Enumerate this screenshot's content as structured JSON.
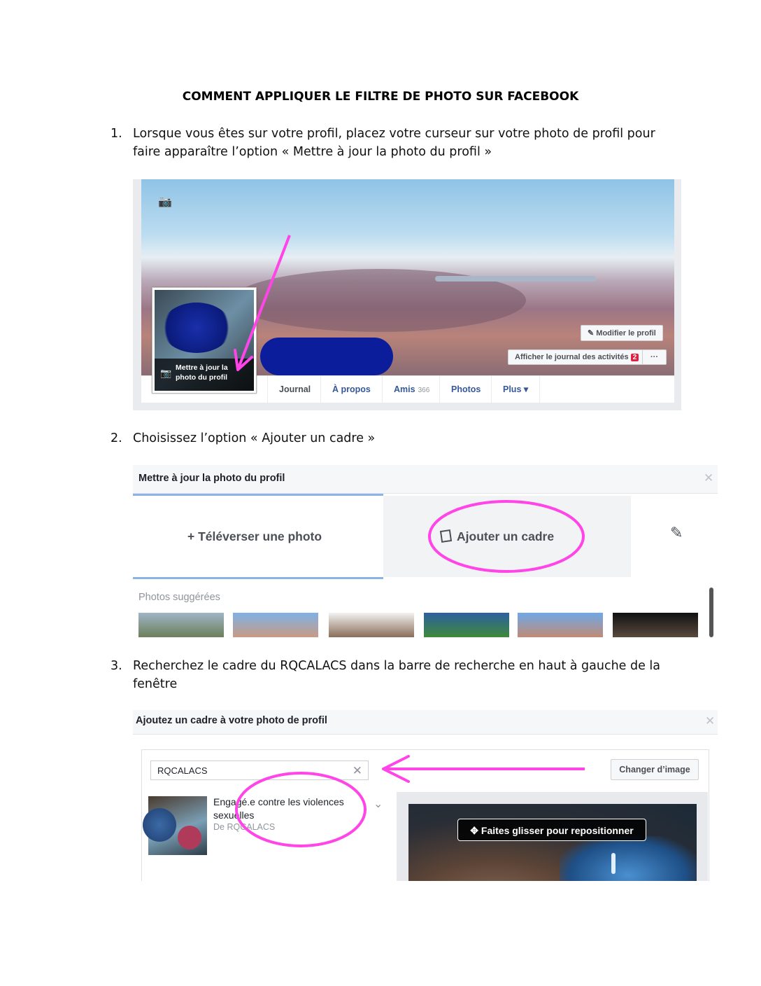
{
  "title": "COMMENT APPLIQUER LE FILTRE DE PHOTO SUR FACEBOOK",
  "steps": [
    {
      "num": "1.",
      "text": "Lorsque vous êtes sur votre profil, placez votre curseur sur votre photo de profil pour faire apparaître l’option « Mettre à jour la photo du profil »"
    },
    {
      "num": "2.",
      "text": "Choisissez l’option « Ajouter un cadre »"
    },
    {
      "num": "3.",
      "text": "Recherchez le cadre du RQCALACS dans la barre de recherche en haut à gauche de la fenêtre"
    }
  ],
  "shot1": {
    "edit_profile": "Modifier le profil",
    "activity_log": "Afficher le journal des activités",
    "activity_badge": "2",
    "more": "···",
    "avatar_overlay": "Mettre à jour la photo du profil",
    "tabs": [
      {
        "label": "Journal",
        "count": ""
      },
      {
        "label": "À propos",
        "count": ""
      },
      {
        "label": "Amis",
        "count": "366"
      },
      {
        "label": "Photos",
        "count": ""
      },
      {
        "label": "Plus ▾",
        "count": ""
      }
    ]
  },
  "shot2": {
    "dialog_title": "Mettre à jour la photo du profil",
    "upload": "+ Téléverser une photo",
    "add_frame": "Ajouter un cadre",
    "suggested": "Photos suggérées"
  },
  "shot3": {
    "dialog_title": "Ajoutez un cadre à votre photo de profil",
    "search_value": "RQCALACS",
    "change_image": "Changer d’image",
    "result_title": "Engagé.e contre les violences sexuelles",
    "result_by": "De RQCALACS",
    "drag_hint": "Faites glisser pour repositionner"
  },
  "colors": {
    "annotation_magenta": "#ff44e8",
    "facebook_link": "#365899",
    "scribble_blue": "#0c1d9b"
  }
}
